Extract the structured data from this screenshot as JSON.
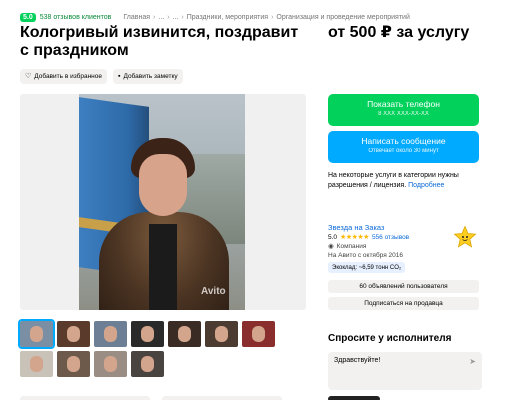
{
  "header": {
    "rating": "5.0",
    "reviews": "538 отзывов клиентов",
    "breadcrumbs": [
      "Главная",
      "...",
      "...",
      "Праздники, мероприятия",
      "Организация и проведение мероприятий"
    ],
    "separator": "›"
  },
  "listing": {
    "title": "Кологривый извинится, поздравит с праздником",
    "price": "от 500 ₽ за услугу",
    "favorite_label": "Добавить в избранное",
    "note_label": "Добавить заметку",
    "watermark": "Avito",
    "thumbnail_count": 11,
    "active_thumbnail_index": 0
  },
  "contact": {
    "phone_label": "Показать телефон",
    "phone_masked": "8 XXX XXX-XX-XX",
    "message_label": "Написать сообщение",
    "message_sub": "Отвечает около 30 минут"
  },
  "license": {
    "text": "На некоторые услуги в категории нужны разрешения / лицензия.",
    "link": "Подробнее"
  },
  "seller": {
    "name": "Звезда на Заказ",
    "rating": "5.0",
    "stars": "★★★★★",
    "reviews": "556 отзывов",
    "type": "Компания",
    "since": "На Авито с октября 2016",
    "eco": "Экоклад: ~6,59 тонн CO₂",
    "ads_button": "60 объявлений пользователя",
    "subscribe_button": "Подписаться на продавца"
  },
  "ask": {
    "heading": "Спросите у исполнителя",
    "input_value": "Здравствуйте!"
  },
  "colors": {
    "green": "#02d15c",
    "blue": "#00aaff",
    "link": "#0a6ad8"
  }
}
